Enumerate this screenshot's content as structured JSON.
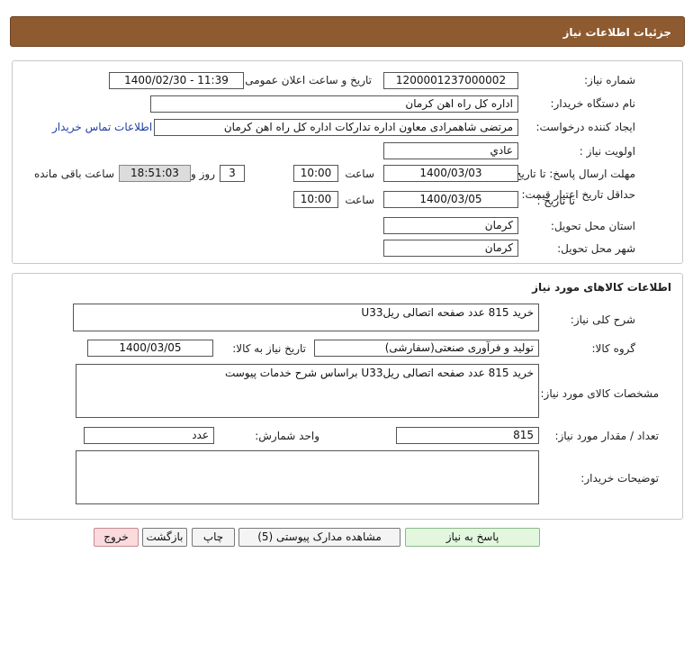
{
  "header": {
    "title": "جزئیات اطلاعات نیاز"
  },
  "info": {
    "need_number_label": "شماره نیاز:",
    "need_number": "1200001237000002",
    "announce_label": "تاریخ و ساعت اعلان عمومی:",
    "announce_value": "1400/02/30 - 11:39",
    "buyer_label": "نام دستگاه خریدار:",
    "buyer_value": "اداره کل راه اهن کرمان",
    "creator_label": "ایجاد کننده درخواست:",
    "creator_value": "مرتضی  شاهمرادی  معاون اداره تدارکات  اداره کل راه اهن کرمان",
    "contact_link": "اطلاعات تماس خریدار",
    "priority_label": "اولویت نیاز :",
    "priority_value": "عادي",
    "send_deadline_label": "مهلت ارسال پاسخ: تا تاریخ :",
    "send_deadline_date": "1400/03/03",
    "time_label": "ساعت",
    "send_deadline_time": "10:00",
    "days_value": "3",
    "days_label": "روز و",
    "remaining_time": "18:51:03",
    "remaining_label": "ساعت باقی مانده",
    "validity_label": "حداقل تاریخ اعتبار قیمت:",
    "validity_to_label": "تا تاریخ :",
    "validity_date": "1400/03/05",
    "validity_time_label": "ساعت",
    "validity_time": "10:00",
    "province_label": "استان محل تحویل:",
    "province_value": "کرمان",
    "city_label": "شهر محل تحویل:",
    "city_value": "کرمان"
  },
  "goods": {
    "section_title": "اطلاعات کالاهای مورد نیاز",
    "summary_label": "شرح کلی نیاز:",
    "summary_value": "خرید 815 عدد صفحه اتصالی ریلU33",
    "group_label": "گروه کالا:",
    "group_value": "تولید و فرآوری صنعتی(سفارشی)",
    "need_date_label": "تاریخ نیاز به کالا:",
    "need_date_value": "1400/03/05",
    "specs_label": "مشخصات کالای مورد نیاز:",
    "specs_value": "خرید 815 عدد صفحه اتصالی ریلU33 براساس شرح خدمات پیوست",
    "qty_label": "تعداد / مقدار مورد نیاز:",
    "qty_value": "815",
    "unit_label": "واحد شمارش:",
    "unit_value": "عدد",
    "buyer_notes_label": "توضیحات خریدار:",
    "buyer_notes_value": ""
  },
  "buttons": {
    "reply": "پاسخ به نیاز",
    "attachments": "مشاهده مدارک پیوستی (5)",
    "print": "چاپ",
    "back": "بازگشت",
    "exit": "خروج"
  },
  "colors": {
    "header_bg": "#8e5a2f",
    "link": "#1e3fa6",
    "reply_bg": "#e3f7df",
    "exit_bg": "#fadadd"
  }
}
